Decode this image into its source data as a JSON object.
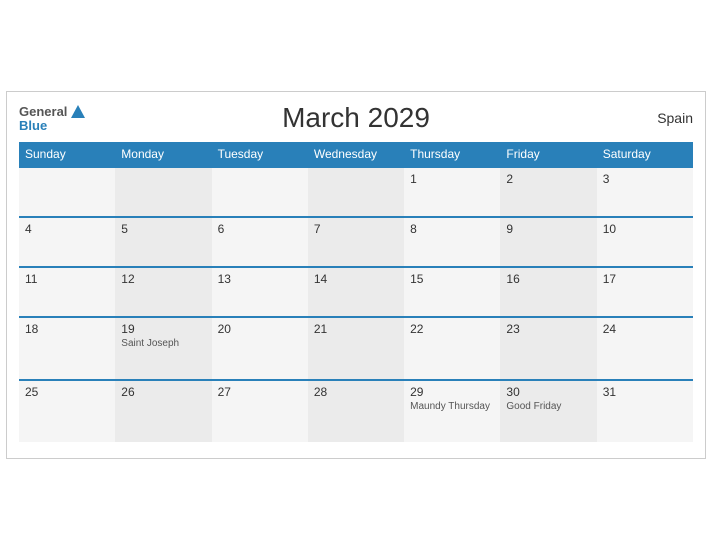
{
  "header": {
    "title": "March 2029",
    "country": "Spain",
    "logo_general": "General",
    "logo_blue": "Blue"
  },
  "weekdays": [
    "Sunday",
    "Monday",
    "Tuesday",
    "Wednesday",
    "Thursday",
    "Friday",
    "Saturday"
  ],
  "weeks": [
    [
      {
        "day": "",
        "holiday": ""
      },
      {
        "day": "",
        "holiday": ""
      },
      {
        "day": "",
        "holiday": ""
      },
      {
        "day": "",
        "holiday": ""
      },
      {
        "day": "1",
        "holiday": ""
      },
      {
        "day": "2",
        "holiday": ""
      },
      {
        "day": "3",
        "holiday": ""
      }
    ],
    [
      {
        "day": "4",
        "holiday": ""
      },
      {
        "day": "5",
        "holiday": ""
      },
      {
        "day": "6",
        "holiday": ""
      },
      {
        "day": "7",
        "holiday": ""
      },
      {
        "day": "8",
        "holiday": ""
      },
      {
        "day": "9",
        "holiday": ""
      },
      {
        "day": "10",
        "holiday": ""
      }
    ],
    [
      {
        "day": "11",
        "holiday": ""
      },
      {
        "day": "12",
        "holiday": ""
      },
      {
        "day": "13",
        "holiday": ""
      },
      {
        "day": "14",
        "holiday": ""
      },
      {
        "day": "15",
        "holiday": ""
      },
      {
        "day": "16",
        "holiday": ""
      },
      {
        "day": "17",
        "holiday": ""
      }
    ],
    [
      {
        "day": "18",
        "holiday": ""
      },
      {
        "day": "19",
        "holiday": "Saint Joseph"
      },
      {
        "day": "20",
        "holiday": ""
      },
      {
        "day": "21",
        "holiday": ""
      },
      {
        "day": "22",
        "holiday": ""
      },
      {
        "day": "23",
        "holiday": ""
      },
      {
        "day": "24",
        "holiday": ""
      }
    ],
    [
      {
        "day": "25",
        "holiday": ""
      },
      {
        "day": "26",
        "holiday": ""
      },
      {
        "day": "27",
        "holiday": ""
      },
      {
        "day": "28",
        "holiday": ""
      },
      {
        "day": "29",
        "holiday": "Maundy Thursday"
      },
      {
        "day": "30",
        "holiday": "Good Friday"
      },
      {
        "day": "31",
        "holiday": ""
      }
    ]
  ]
}
